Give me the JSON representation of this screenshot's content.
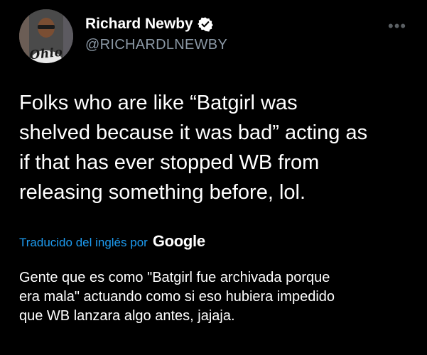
{
  "author": {
    "display_name": "Richard Newby",
    "handle": "@RICHARDLNEWBY",
    "avatar_text": "Ohio",
    "verified_icon": "verified-badge-icon"
  },
  "menu": {
    "more_label": "•••"
  },
  "tweet": {
    "text": "Folks who are like “Batgirl was\nshelved because it was bad” acting as\nif that has ever stopped WB from\nreleasing something before, lol."
  },
  "translation": {
    "label": "Traducido del inglés por",
    "provider": "Google",
    "text": "Gente que es como \"Batgirl fue archivada porque\nera mala\" actuando como si eso hubiera impedido\nque WB lanzara algo antes, jajaja."
  },
  "colors": {
    "background": "#000000",
    "primary_text": "#ffffff",
    "secondary_text": "#8b98a5",
    "link": "#1d9bf0",
    "verified": "#ffffff"
  }
}
